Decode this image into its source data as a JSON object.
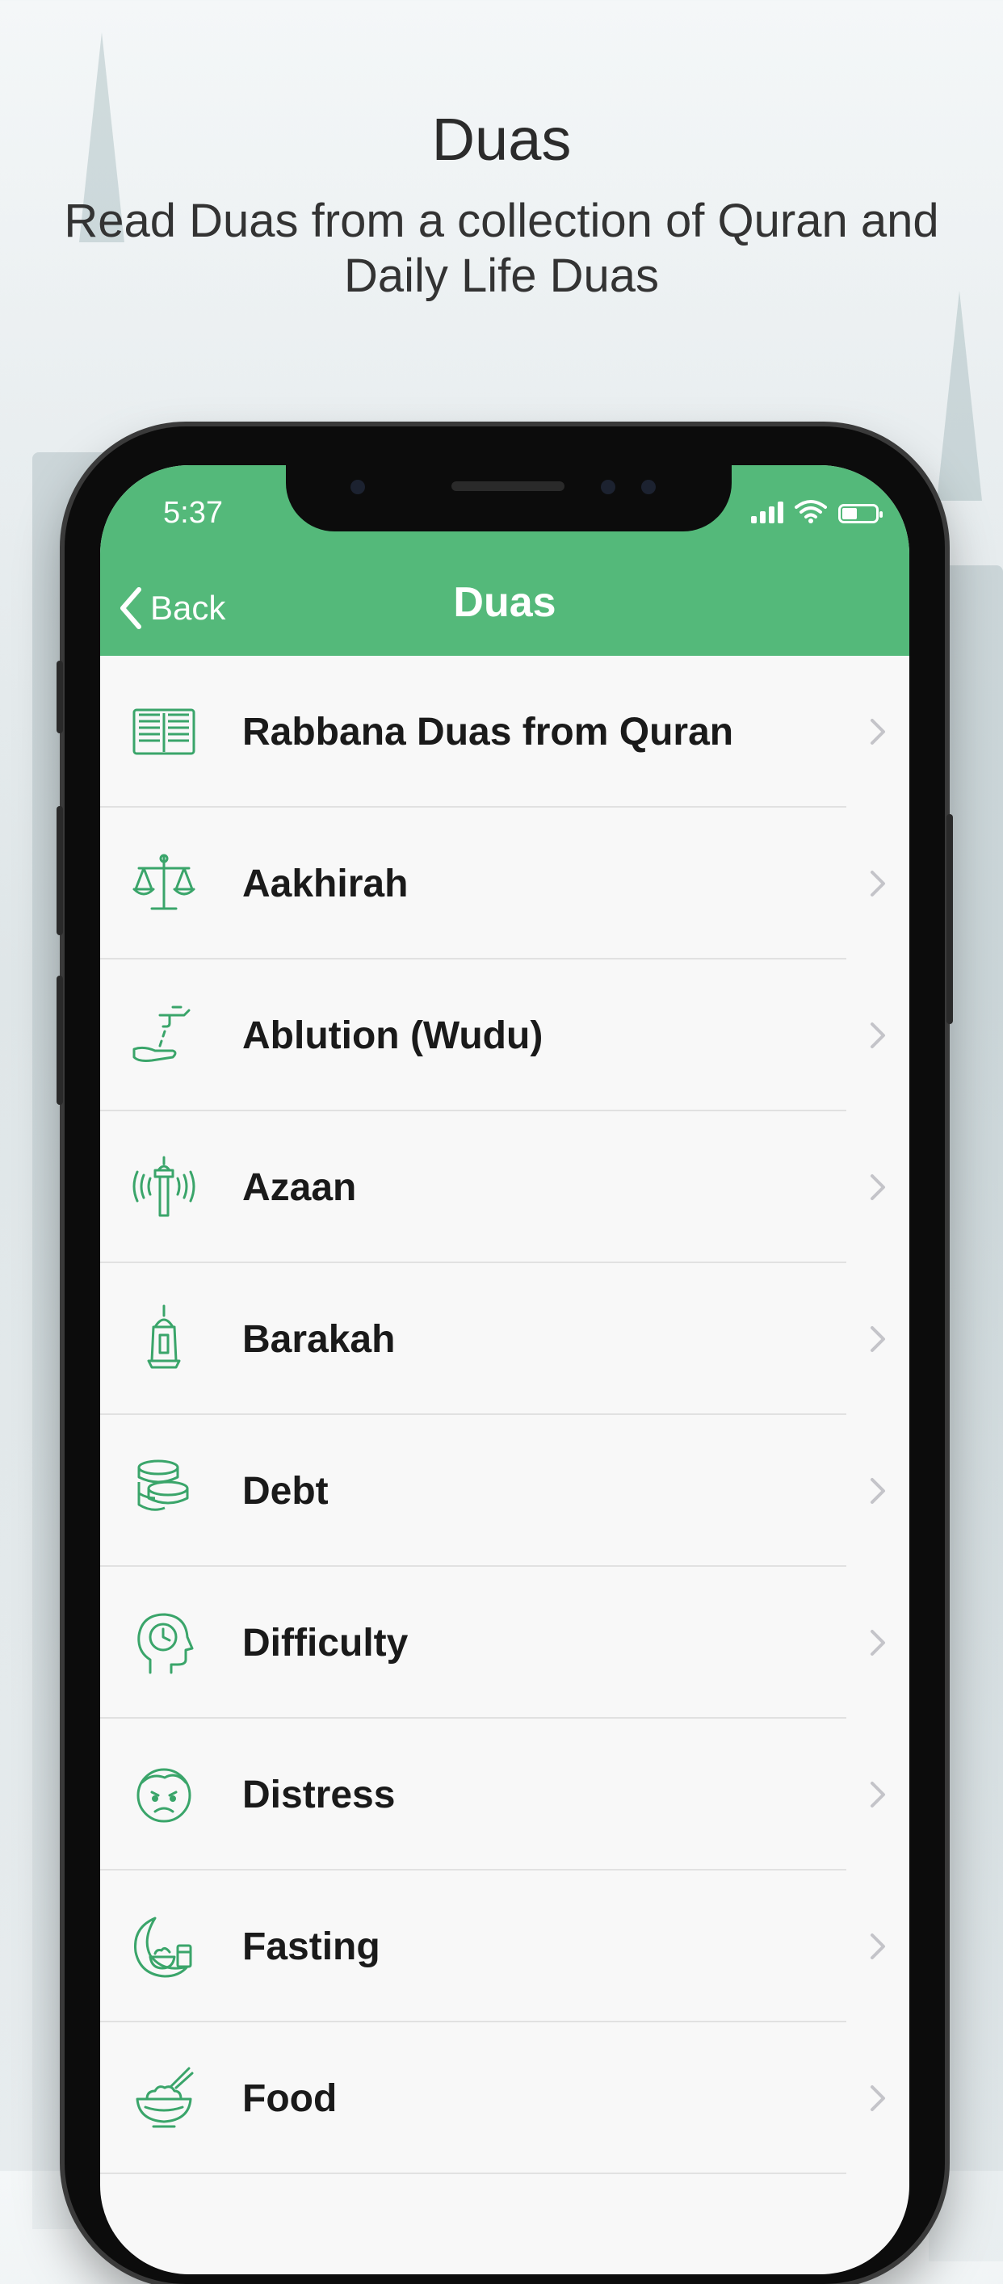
{
  "promo": {
    "title": "Duas",
    "subtitle": "Read Duas from a collection of Quran and Daily Life Duas"
  },
  "status_bar": {
    "time": "5:37"
  },
  "nav": {
    "back_label": "Back",
    "title": "Duas"
  },
  "colors": {
    "accent": "#54b97a",
    "icon_green": "#3aa56a",
    "chevron": "#c4c4c9"
  },
  "items": [
    {
      "label": "Rabbana Duas from Quran",
      "icon": "quran-book-icon"
    },
    {
      "label": "Aakhirah",
      "icon": "scales-icon"
    },
    {
      "label": "Ablution (Wudu)",
      "icon": "tap-hand-icon"
    },
    {
      "label": "Azaan",
      "icon": "minaret-loudspeaker-icon"
    },
    {
      "label": "Barakah",
      "icon": "lantern-icon"
    },
    {
      "label": "Debt",
      "icon": "coins-icon"
    },
    {
      "label": "Difficulty",
      "icon": "head-clock-icon"
    },
    {
      "label": "Distress",
      "icon": "sad-face-icon"
    },
    {
      "label": "Fasting",
      "icon": "crescent-food-icon"
    },
    {
      "label": "Food",
      "icon": "bowl-icon"
    }
  ]
}
